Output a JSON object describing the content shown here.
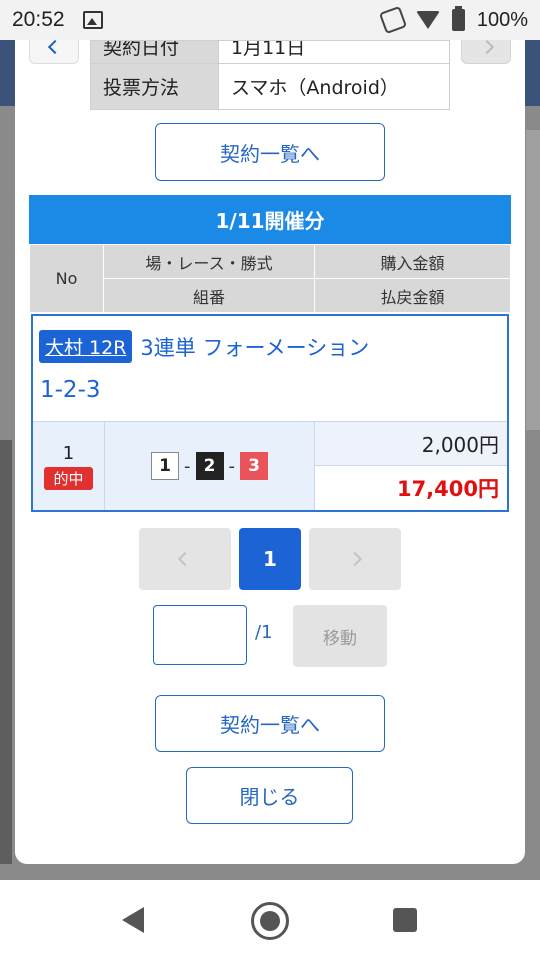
{
  "status_bar": {
    "time": "20:52",
    "battery": "100%"
  },
  "info": {
    "contract_date_label": "契約日付",
    "contract_date_value": "1月11日",
    "method_label": "投票方法",
    "method_value": "スマホ（Android）"
  },
  "buttons": {
    "contract_list_top": "契約一覧へ",
    "contract_list_bottom": "契約一覧へ",
    "close": "閉じる",
    "move": "移動"
  },
  "session": {
    "header": "1/11開催分",
    "columns": {
      "no": "No",
      "venue_race_type": "場・レース・勝式",
      "purchase_amount": "購入金額",
      "combination": "組番",
      "payout_amount": "払戻金額"
    }
  },
  "record": {
    "venue_race": "大村 12R",
    "bet_type": "3連単 フォーメーション",
    "combination_text": "1-2-3",
    "no": "1",
    "hit_label": "的中",
    "lanes": [
      "1",
      "2",
      "3"
    ],
    "separator": "-",
    "purchase": "2,000円",
    "payout": "17,400円"
  },
  "pagination": {
    "current": "1",
    "total": "/1",
    "input_value": ""
  },
  "colors": {
    "primary": "#1c63d6",
    "header": "#1b8ae7",
    "hit": "#e03030",
    "payout": "#e01010"
  }
}
